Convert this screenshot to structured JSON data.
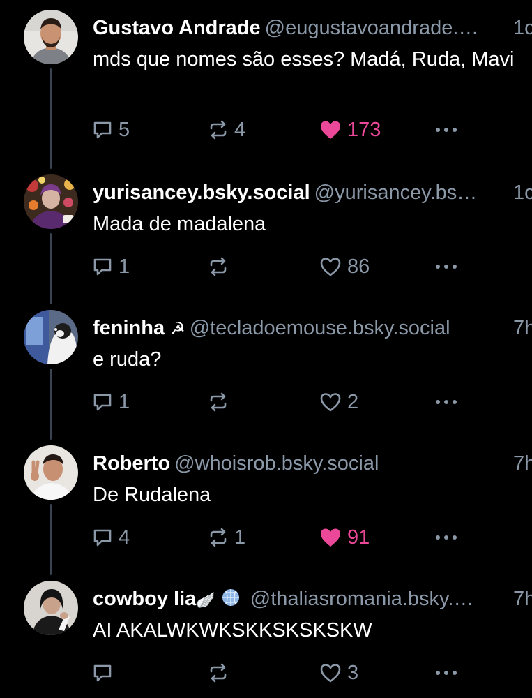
{
  "colors": {
    "background": "#000000",
    "text": "#ffffff",
    "muted": "#8b98a8",
    "like_active": "#ec4899",
    "thread_line": "#3a4452"
  },
  "posts": [
    {
      "display_name": "Gustavo Andrade",
      "handle": "@eugustavoandrade.…",
      "time": "1c",
      "text": "mds que nomes são esses? Madá, Ruda, Mavi",
      "replies": "5",
      "reposts": "4",
      "likes": "173",
      "liked": true,
      "avatar": "avatar-man-beard"
    },
    {
      "display_name": "yurisancey.bsky.social",
      "handle": "@yurisancey.bs…",
      "time": "1c",
      "text": "Mada de madalena",
      "replies": "1",
      "reposts": "",
      "likes": "86",
      "liked": false,
      "avatar": "avatar-flowers"
    },
    {
      "display_name": "feninha",
      "name_suffix": "☭",
      "handle": "@tecladoemouse.bsky.social",
      "time": "7h",
      "text": "e ruda?",
      "replies": "1",
      "reposts": "",
      "likes": "2",
      "liked": false,
      "avatar": "avatar-cat"
    },
    {
      "display_name": "Roberto",
      "handle": "@whoisrob.bsky.social",
      "time": "7h",
      "text": "De Rudalena",
      "replies": "4",
      "reposts": "1",
      "likes": "91",
      "liked": true,
      "avatar": "avatar-man-peace"
    },
    {
      "display_name": "cowboy lia",
      "name_suffix": "🪽",
      "handle": "@thaliasromania.bsky.…",
      "time": "7h",
      "text": "AI AKALWKWKSKKSKSKSKW",
      "replies": "",
      "reposts": "",
      "likes": "3",
      "liked": false,
      "avatar": "avatar-singer"
    }
  ]
}
